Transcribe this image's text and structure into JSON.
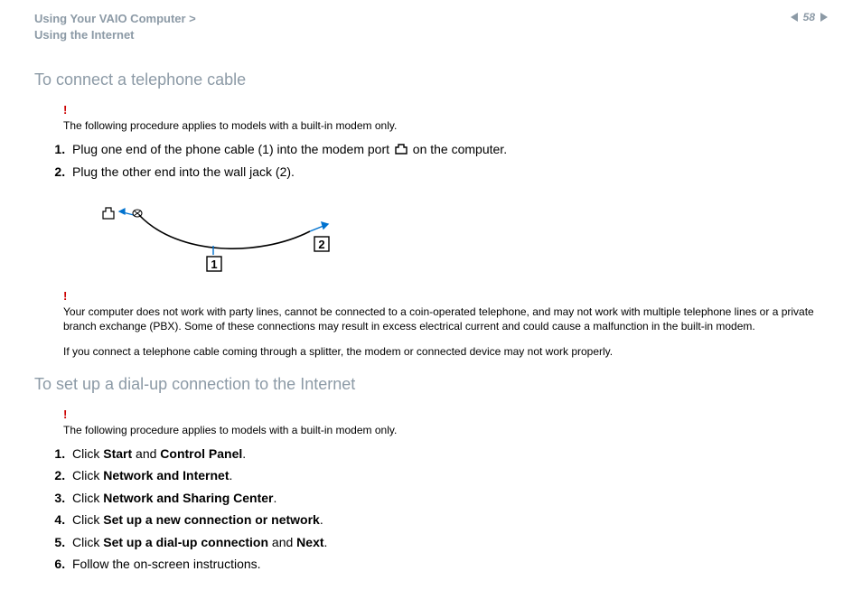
{
  "header": {
    "crumb1": "Using Your VAIO Computer >",
    "crumb2": "Using the Internet",
    "page_number": "58"
  },
  "section1": {
    "title": "To connect a telephone cable",
    "note1": "The following procedure applies to models with a built-in modem only.",
    "step1_pre": "Plug one end of the phone cable (1) into the modem port ",
    "step1_post": " on the computer.",
    "step2": "Plug the other end into the wall jack (2).",
    "diagram_label1": "1",
    "diagram_label2": "2",
    "note2a": "Your computer does not work with party lines, cannot be connected to a coin-operated telephone, and may not work with multiple telephone lines or a private branch exchange (PBX). Some of these connections may result in excess electrical current and could cause a malfunction in the built-in modem.",
    "note2b": "If you connect a telephone cable coming through a splitter, the modem or connected device may not work properly."
  },
  "section2": {
    "title": "To set up a dial-up connection to the Internet",
    "note1": "The following procedure applies to models with a built-in modem only.",
    "step1": "Click <strong>Start</strong> and <strong>Control Panel</strong>.",
    "step2": "Click <strong>Network and Internet</strong>.",
    "step3": "Click <strong>Network and Sharing Center</strong>.",
    "step4": "Click <strong>Set up a new connection or network</strong>.",
    "step5": "Click <strong>Set up a dial-up connection</strong> and <strong>Next</strong>.",
    "step6": "Follow the on-screen instructions."
  }
}
